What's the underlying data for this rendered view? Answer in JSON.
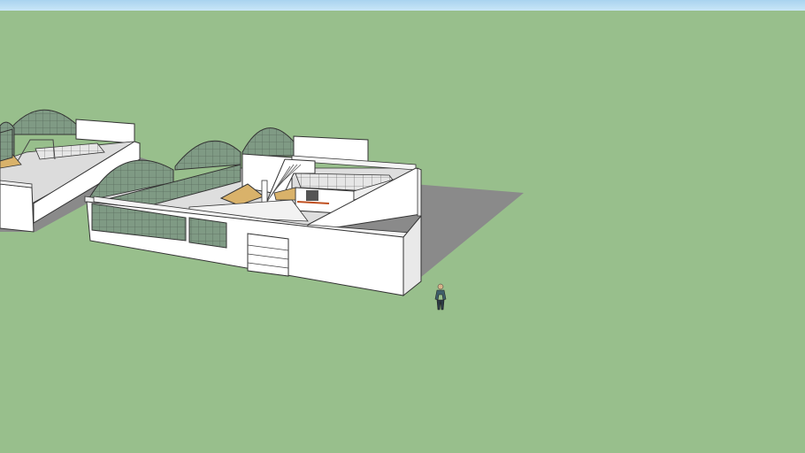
{
  "viewport": {
    "sky_color": "#bfe1f5",
    "ground_color": "#98bf8c",
    "shadow_color": "#8a8a8a"
  },
  "model": {
    "wall_color": "#ffffff",
    "floor_color": "#dcdcdc",
    "glass_color": "#7f9a84",
    "canopy_color": "#d9b26a",
    "figure_color": "#3f5f6a"
  }
}
